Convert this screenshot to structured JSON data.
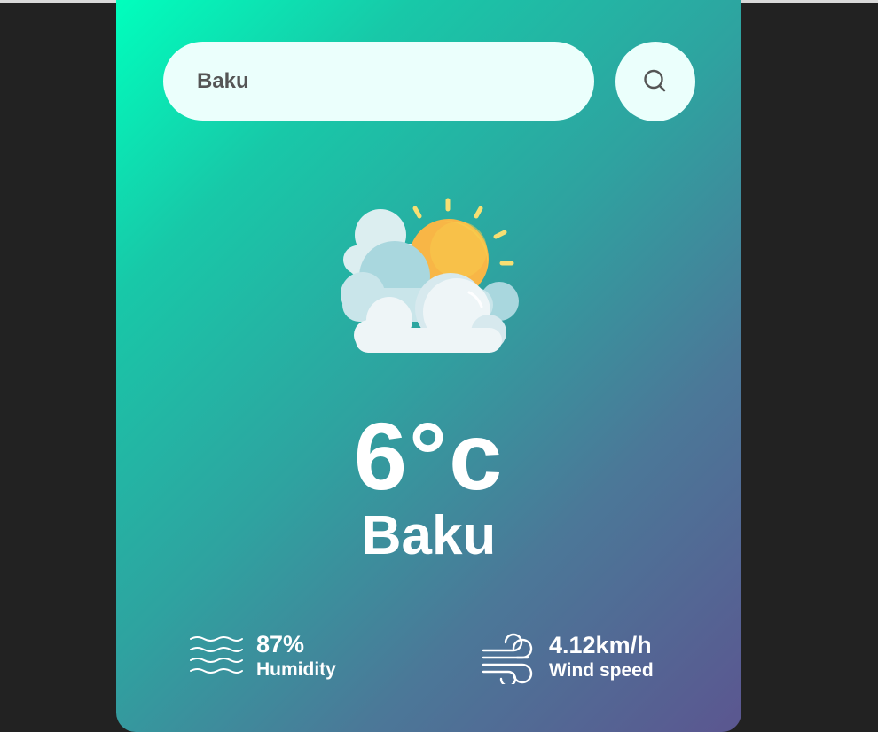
{
  "search": {
    "value": "Baku",
    "icon": "search-icon"
  },
  "weather": {
    "icon": "partly-cloudy-icon",
    "temperature": "6°c",
    "city": "Baku"
  },
  "details": {
    "humidity": {
      "icon": "humidity-icon",
      "value": "87%",
      "label": "Humidity"
    },
    "wind": {
      "icon": "wind-icon",
      "value": "4.12km/h",
      "label": "Wind speed"
    }
  },
  "colors": {
    "page_background": "#222222",
    "gradient_start": "#00ffbd",
    "gradient_end": "#5b5690",
    "input_background": "#ebfffc",
    "text_light": "#ffffff",
    "text_dark": "#555555"
  }
}
